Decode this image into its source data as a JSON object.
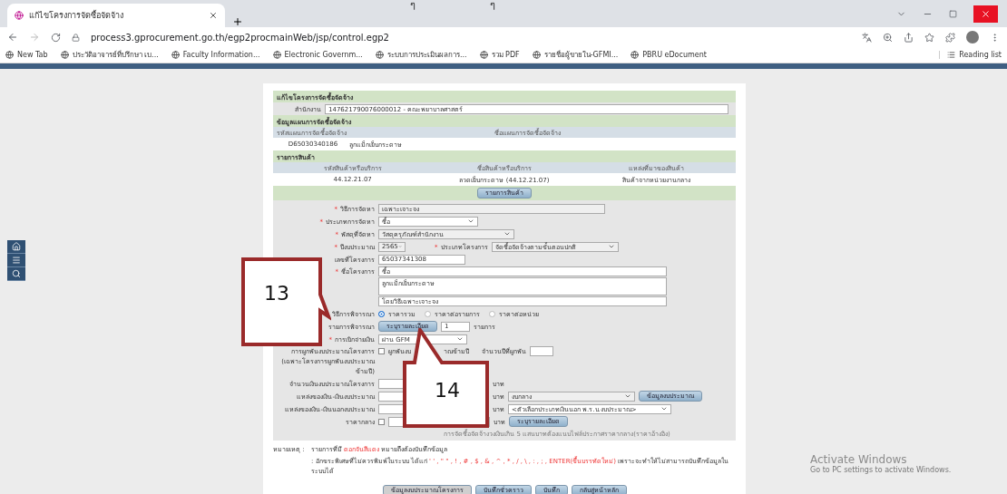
{
  "browser": {
    "tab_title": "แก้ไขโครงการจัดซื้อจัดจ้าง",
    "url": "process3.gprocurement.go.th/egp2procmainWeb/jsp/control.egp2",
    "top_marks": [
      "ๆ",
      "ๆ"
    ],
    "bookmarks": [
      {
        "label": "New Tab"
      },
      {
        "label": "ประวัติอาจารย์ที่ปรึกษา เบ..."
      },
      {
        "label": "Faculty Information..."
      },
      {
        "label": "Electronic Governm..."
      },
      {
        "label": "ระบบการประเมินผลการ..."
      },
      {
        "label": "รวม PDF"
      },
      {
        "label": "รายชื่อผู้ขายใน-GFMI..."
      },
      {
        "label": "PBRU eDocument"
      }
    ],
    "reading_list": "Reading list"
  },
  "form": {
    "title": "แก้ไขโครงการจัดซื้อจัดจ้าง",
    "office_label": "สำนักงาน",
    "office_value": "147621790076000012 - คณะพยาบาลศาสตร์",
    "plan_section": "ข้อมูลแผนการจัดซื้อจัดจ้าง",
    "plan_columns": [
      "รหัสแผนการจัดซื้อจัดจ้าง",
      "ชื่อแผนการจัดซื้อจัดจ้าง"
    ],
    "plan_row": [
      "D65030340186",
      "ลูกแม็กเย็บกระดาษ"
    ],
    "items_section": "รายการสินค้า",
    "items_columns": [
      "รหัสสินค้าหรือบริการ",
      "ชื่อสินค้าหรือบริการ",
      "แหล่งที่มาของสินค้า"
    ],
    "items_row": [
      "44.12.21.07",
      "ลวดเย็บกระดาษ (44.12.21.07)",
      "สินค้าจากหน่วยงานกลาง"
    ],
    "items_button": "รายการสินค้า",
    "method_req": "*",
    "method_label": "วิธีการจัดหา",
    "method_value": "เฉพาะเจาะจง",
    "type_req": "*",
    "type_label": "ประเภทการจัดหา",
    "type_value": "ซื้อ",
    "supply_req": "*",
    "supply_label": "พัสดุที่จัดหา",
    "supply_value": "วัสดุครุภัณฑ์สำนักงาน",
    "year_req": "*",
    "year_label": "ปีงบประมาณ",
    "year_value": "2565",
    "project_type_req": "*",
    "project_type_label": "ประเภทโครงการ",
    "project_type_value": "จัดซื้อจัดจ้างตามขั้นตอนปกติ",
    "project_no_label": "เลขที่โครงการ",
    "project_no_value": "65037341308",
    "project_name_req": "*",
    "project_name_label": "ชื่อโครงการ",
    "project_name_lines": [
      "ซื้อ",
      "ลูกแม็กเย็บกระดาษ",
      "โดยวิธีเฉพาะเจาะจง"
    ],
    "consider_label": "วิธีการพิจารณา",
    "consider_options": [
      {
        "label": "ราคารวม",
        "selected": true
      },
      {
        "label": "ราคาต่อรายการ",
        "selected": false
      },
      {
        "label": "ราคาต่อหน่วย",
        "selected": false
      }
    ],
    "consider_items_label": "รายการพิจารณา",
    "consider_items_button": "ระบุรายละเอียด",
    "consider_items_value": "1",
    "consider_items_unit": "รายการ",
    "payment_req": "*",
    "payment_label": "การเบิกจ่ายเงิน",
    "payment_value": "ผ่าน GFM",
    "commit_label": "การผูกพันงบประมาณโครงการ",
    "commit_note": "(เฉพาะโครงการผูกพันงบประมาณข้ามปี)",
    "commit_check": {
      "label_start": "ผูกพันงบ",
      "label_end": "าณข้ามปี",
      "checked": false
    },
    "commit_years_label": "จำนวนปีที่ผูกพัน",
    "budget_label": "จำนวนเงินงบประมาณโครงการ",
    "budget_unit": "บาท",
    "source_label": "แหล่งของเงิน-เงินงบประมาณ",
    "source_unit": "บาท",
    "source_select": "งบกลาง",
    "source_button": "ข้อมูลงบประมาณ",
    "ext_label": "แหล่งของเงิน-เงินนอกงบประมาณ",
    "ext_unit": "บาท",
    "ext_select": "<ตัวเลือกประเภทเงินนอก พ.ร.บ.งบประมาณ>",
    "price_label": "ราคากลาง",
    "price_checked": false,
    "price_unit": "บาท",
    "price_button": "ระบุรายละเอียด",
    "price_note": "การจัดซื้อจัดจ้างวงเงินเกิน 5 แสนบาทต้องแนบไฟล์ประกาศราคากลาง(ราคาอ้างอิง)",
    "remark_label": "หมายเหตุ :",
    "remark_1_start": "รายการที่มี",
    "remark_1_red": "ดอกจันสีแดง",
    "remark_1_end": "หมายถึงต้องบันทึกข้อมูล",
    "remark_2_start": ": อักขระพิเศษที่ไม่ควรพิมพ์ในระบบ ได้แก่",
    "remark_2_red": "' ' , \" \" , ! , # , $ , & , ^ , * , / , \\ , : , ; , ENTER(ขึ้นบรรทัดใหม่)",
    "remark_2_end": "เพราะจะทำให้ไม่สามารถบันทึกข้อมูลในระบบได้",
    "buttons": [
      {
        "label": "ข้อมูลงบประมาณโครงการ",
        "kind": "grey"
      },
      {
        "label": "บันทึกชั่วคราว",
        "kind": "blue"
      },
      {
        "label": "บันทึก",
        "kind": "blue"
      },
      {
        "label": "กลับสู่หน้าหลัก",
        "kind": "blue"
      }
    ]
  },
  "callouts": [
    {
      "label": "13"
    },
    {
      "label": "14"
    }
  ],
  "os_notice": {
    "title": "Activate Windows",
    "text": "Go to PC settings to activate Windows."
  }
}
